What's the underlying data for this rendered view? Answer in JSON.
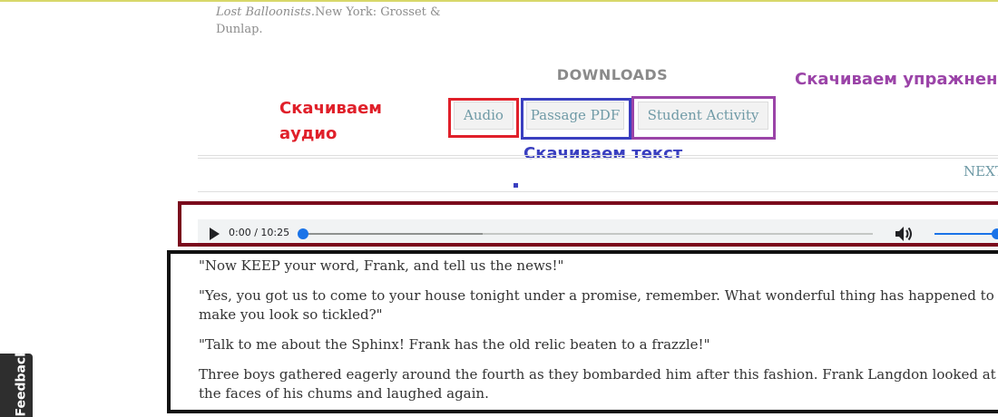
{
  "citation": {
    "title": "Lost Balloonists.",
    "publisher_prefix": "New York: Grosset &",
    "publisher_suffix": "Dunlap."
  },
  "downloads": {
    "heading": "DOWNLOADS",
    "buttons": [
      {
        "label": "Audio"
      },
      {
        "label": "Passage PDF"
      },
      {
        "label": "Student Activity"
      }
    ]
  },
  "annotations": {
    "audio_line1": "Скачиваем",
    "audio_line2": "аудио",
    "text": "Скачиваем текст",
    "activity": "Скачиваем упражнен",
    "colors": {
      "audio": "#e0202a",
      "text": "#3a3fc0",
      "activity": "#9b44a8",
      "player_frame": "#7a0a1c",
      "text_frame": "#111111"
    }
  },
  "navigation": {
    "next_label": "NEXT"
  },
  "player": {
    "time": "0:00 / 10:25",
    "play_icon": "play-icon",
    "volume_icon": "volume-icon",
    "progress": 0,
    "volume": 1.0
  },
  "passage": {
    "paragraphs": [
      "\"Now KEEP your word, Frank, and tell us the news!\"",
      "\"Yes, you got us to come to your house tonight under a promise, remember. What wonderful thing has happened to make you look so tickled?\"",
      "\"Talk to me about the Sphinx! Frank has the old relic beaten to a frazzle!\"",
      "Three boys gathered eagerly around the fourth as they bombarded him after this fashion. Frank Langdon looked at the faces of his chums and laughed again."
    ]
  },
  "feedback": {
    "label": "Feedback"
  }
}
